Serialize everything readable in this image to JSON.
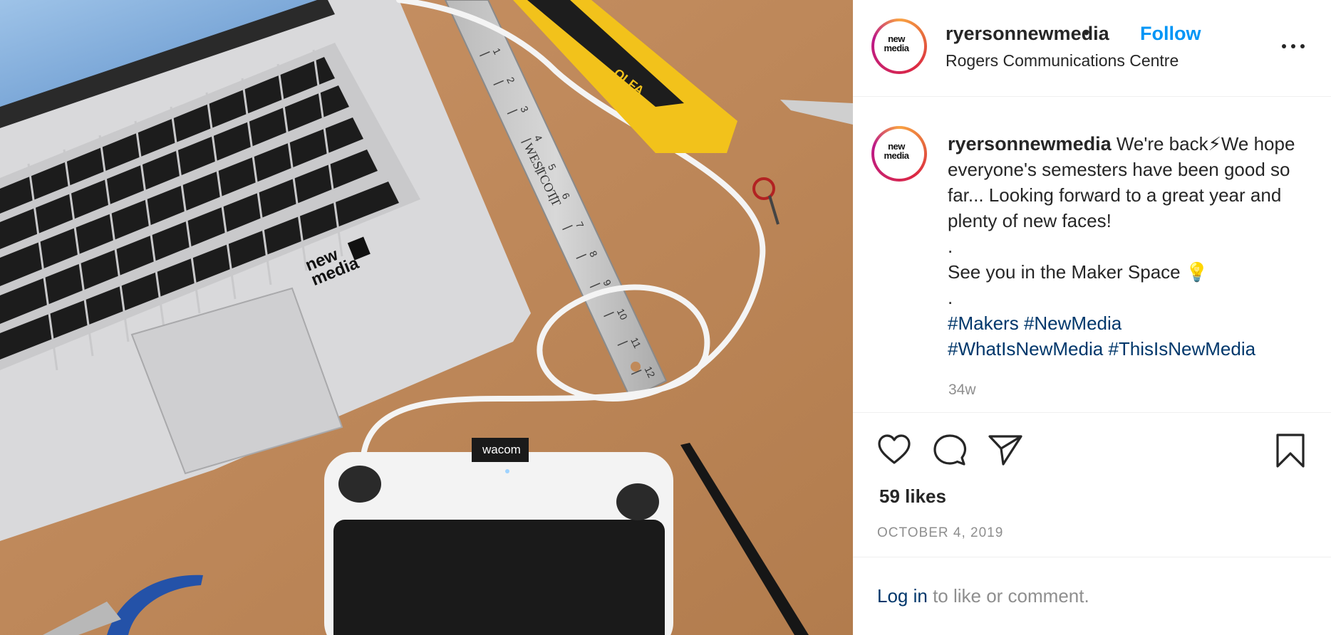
{
  "post": {
    "username": "ryersonnewmedia",
    "follow_label": "Follow",
    "separator": "•",
    "location": "Rogers Communications Centre",
    "avatar_text_line1": "new",
    "avatar_text_line2": "media"
  },
  "caption": {
    "username": "ryersonnewmedia",
    "text_line1": "We're back⚡We hope everyone's semesters have been good so far... Looking forward to a great year and plenty of new faces!",
    "dot1": ".",
    "text_line2": "See you in the Maker Space 💡",
    "dot2": ".",
    "hashtags": [
      "#Makers",
      "#NewMedia",
      "#WhatIsNewMedia",
      "#ThisIsNewMedia"
    ],
    "time_ago": "34w"
  },
  "actions": {
    "like_icon": "heart-icon",
    "comment_icon": "comment-icon",
    "share_icon": "paper-plane-icon",
    "save_icon": "bookmark-icon"
  },
  "stats": {
    "likes": "59 likes",
    "date": "OCTOBER 4, 2019"
  },
  "footer": {
    "login_link": "Log in",
    "login_suffix": " to like or comment."
  },
  "photo": {
    "laptop_sticker_line1": "new",
    "laptop_sticker_line2": "media",
    "tablet_brand": "wacom",
    "ruler_brand": "WESTCOTT",
    "ruler_numbers": [
      "1",
      "2",
      "3",
      "4",
      "5",
      "6",
      "7",
      "8",
      "9",
      "10",
      "11",
      "12"
    ],
    "knife_brand": "OLFA"
  },
  "colors": {
    "accent_blue": "#0095f6",
    "hashtag_blue": "#00376b",
    "muted_gray": "#8e8e8e",
    "desk_brown": "#c08a5a"
  }
}
